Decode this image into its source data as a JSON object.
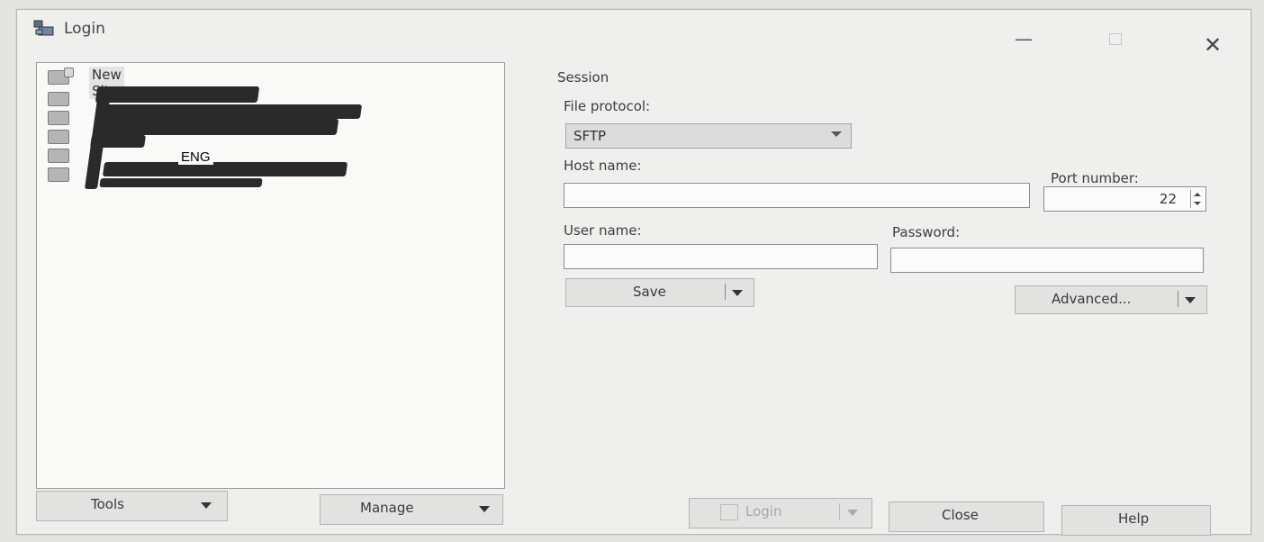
{
  "window": {
    "title": "Login"
  },
  "tree": {
    "new_site": "New Site",
    "overlay_text": "ENG"
  },
  "session": {
    "heading": "Session",
    "file_protocol_label": "File protocol:",
    "file_protocol_value": "SFTP",
    "host_name_label": "Host name:",
    "host_name_value": "",
    "port_number_label": "Port number:",
    "port_number_value": "22",
    "user_name_label": "User name:",
    "user_name_value": "",
    "password_label": "Password:",
    "password_value": ""
  },
  "buttons": {
    "save": "Save",
    "advanced": "Advanced...",
    "tools": "Tools",
    "manage": "Manage",
    "login": "Login",
    "close": "Close",
    "help": "Help"
  }
}
